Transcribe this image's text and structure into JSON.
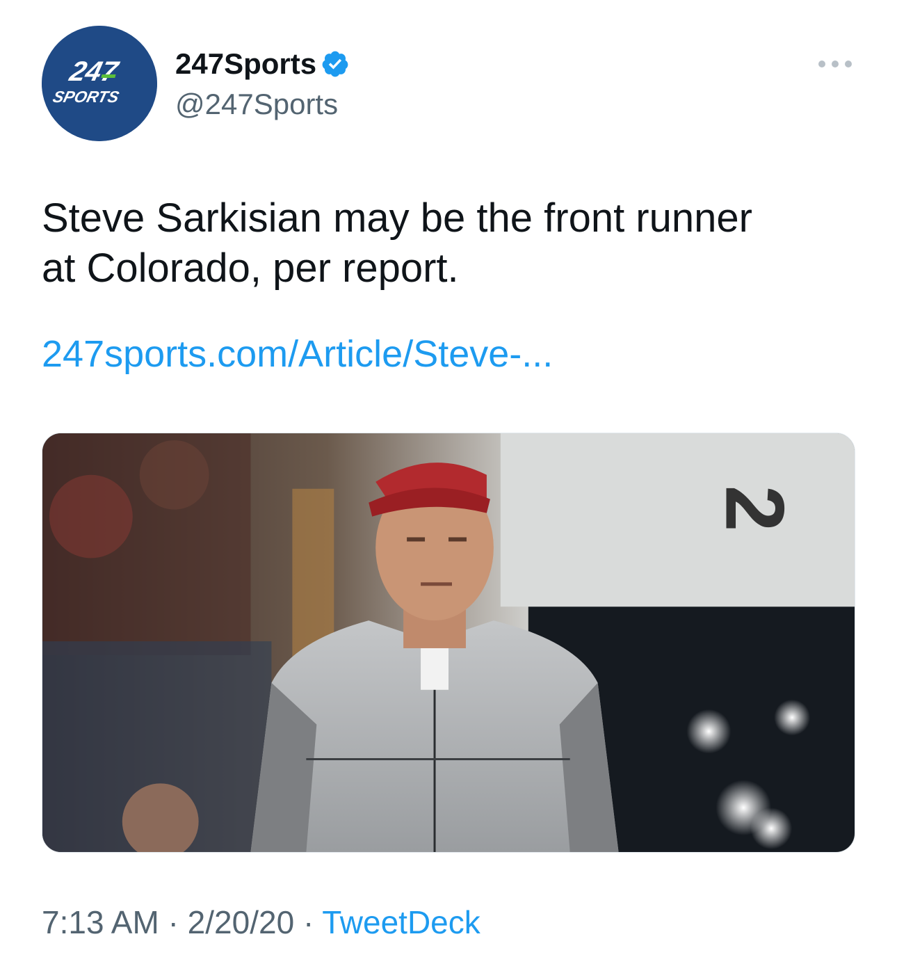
{
  "author": {
    "avatar_line1": "247",
    "avatar_line2": "SPORTS",
    "display_name": "247Sports",
    "handle": "@247Sports",
    "verified": true
  },
  "tweet": {
    "text": "Steve Sarkisian may be the front runner\nat Colorado, per report.",
    "link": "247sports.com/Article/Steve-...",
    "image_text": "2"
  },
  "meta": {
    "time": "7:13 AM",
    "separator": "·",
    "date": "2/20/20",
    "source": "TweetDeck"
  },
  "colors": {
    "link": "#1d9bf0",
    "avatar_bg": "#1f4a86",
    "avatar_green": "#5cbf3a",
    "secondary_text": "#536471"
  },
  "icons": [
    "more-options-icon",
    "verified-badge-icon"
  ]
}
